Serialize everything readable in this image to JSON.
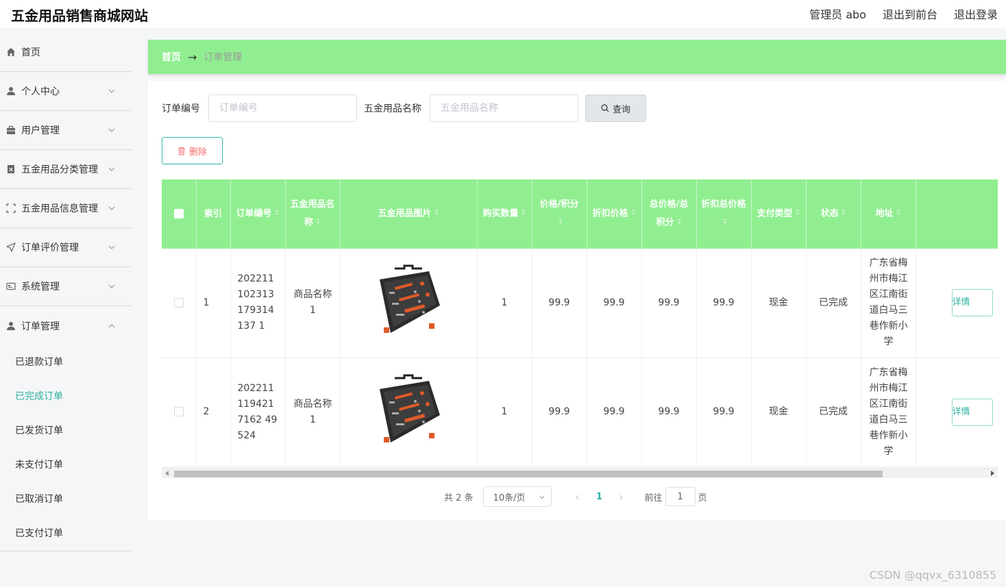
{
  "header": {
    "title": "五金用品销售商城网站",
    "admin": "管理员 abo",
    "to_front": "退出到前台",
    "logout": "退出登录"
  },
  "sidebar": {
    "items": [
      {
        "label": "首页",
        "icon": "home-icon"
      },
      {
        "label": "个人中心",
        "icon": "user-icon"
      },
      {
        "label": "用户管理",
        "icon": "briefcase-icon"
      },
      {
        "label": "五金用品分类管理",
        "icon": "category-icon"
      },
      {
        "label": "五金用品信息管理",
        "icon": "scan-icon"
      },
      {
        "label": "订单评价管理",
        "icon": "send-icon"
      },
      {
        "label": "系统管理",
        "icon": "card-icon"
      },
      {
        "label": "订单管理",
        "icon": "user-icon"
      }
    ],
    "sub_items": [
      "已退款订单",
      "已完成订单",
      "已发货订单",
      "未支付订单",
      "已取消订单",
      "已支付订单"
    ],
    "active_sub": "已完成订单"
  },
  "breadcrumb": {
    "home": "首页",
    "arrow": "→",
    "current": "订单管理"
  },
  "search": {
    "order_no_label": "订单编号",
    "order_no_placeholder": "订单编号",
    "product_name_label": "五金用品名称",
    "product_name_placeholder": "五金用品名称",
    "query_label": "查询"
  },
  "actions": {
    "delete_label": "删除"
  },
  "table": {
    "columns": [
      "索引",
      "订单编号",
      "五金用品名称",
      "五金用品图片",
      "购买数量",
      "价格/积分",
      "折扣价格",
      "总价格/总积分",
      "折扣总价格",
      "支付类型",
      "状态",
      "地址"
    ],
    "rows": [
      {
        "index": "1",
        "order_no": "202211102313179314137 1",
        "name": "商品名称1",
        "qty": "1",
        "price": "99.9",
        "discount_price": "99.9",
        "total": "99.9",
        "discount_total": "99.9",
        "pay_type": "现金",
        "status": "已完成",
        "address": "广东省梅州市梅江区江南街道白马三巷作新小学",
        "action": "详情"
      },
      {
        "index": "2",
        "order_no": "2022111194217162 49524",
        "name": "商品名称1",
        "qty": "1",
        "price": "99.9",
        "discount_price": "99.9",
        "total": "99.9",
        "discount_total": "99.9",
        "pay_type": "现金",
        "status": "已完成",
        "address": "广东省梅州市梅江区江南街道白马三巷作新小学",
        "action": "详情"
      }
    ]
  },
  "pagination": {
    "total": "共 2 条",
    "page_size": "10条/页",
    "prev": "‹",
    "current": "1",
    "next": "›",
    "goto": "前往",
    "goto_value": "1",
    "page_unit": "页"
  },
  "watermark": "CSDN @qqvx_6310855",
  "colors": {
    "accent_green": "#90ee90",
    "teal": "#2bb2a0",
    "danger": "#f56c6c"
  }
}
